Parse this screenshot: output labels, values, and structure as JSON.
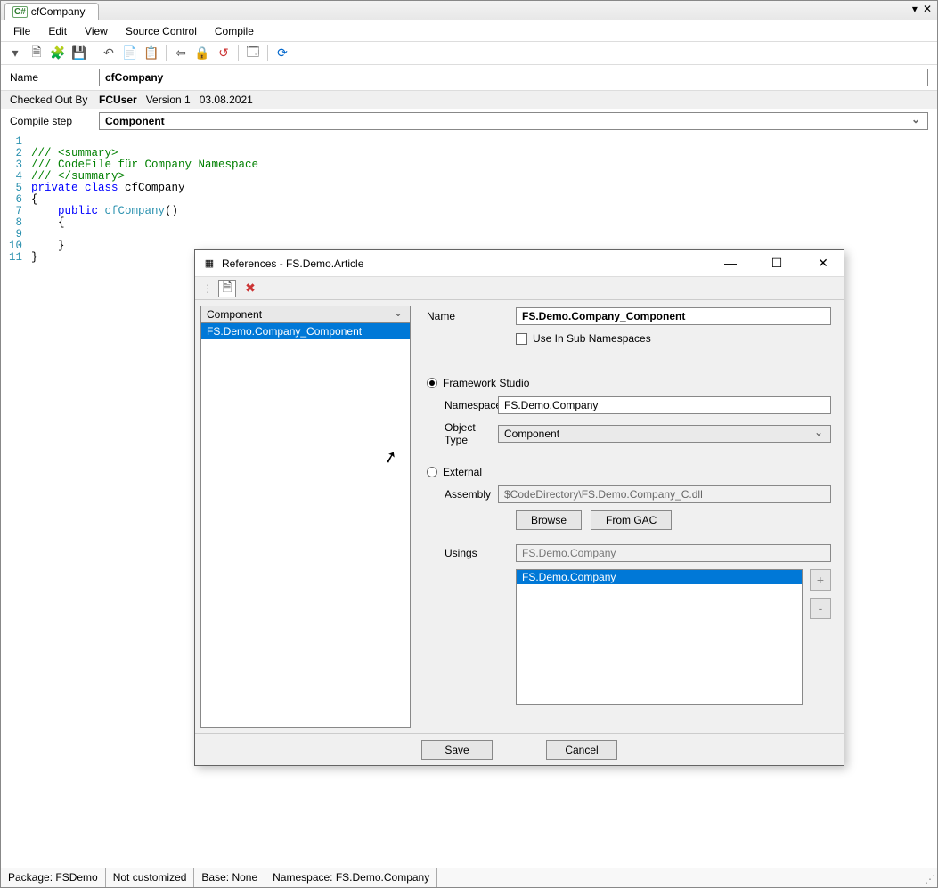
{
  "tab": {
    "label": "cfCompany",
    "badge": "C#"
  },
  "menus": [
    "File",
    "Edit",
    "View",
    "Source Control",
    "Compile"
  ],
  "form": {
    "name_label": "Name",
    "name_value": "cfCompany",
    "checkedout_label": "Checked Out By",
    "checkedout_value": "FCUser",
    "version_label": "Version 1",
    "date_value": "03.08.2021",
    "compilestep_label": "Compile step",
    "compilestep_value": "Component"
  },
  "code": {
    "l1a": "///",
    "l1b": " <summary>",
    "l2a": "///",
    "l2b": " CodeFile für Company Namespace",
    "l3a": "///",
    "l3b": " </summary>",
    "l4a": "private",
    "l4b": " class",
    "l4c": " cfCompany",
    "l5": "{",
    "l6a": "    public",
    "l6b": " cfCompany",
    "l6c": "()",
    "l7": "    {",
    "l9": "    }",
    "l10": "}"
  },
  "lines": [
    "1",
    "2",
    "3",
    "4",
    "5",
    "6",
    "7",
    "8",
    "9",
    "10",
    "11"
  ],
  "dialog": {
    "title": "References - FS.Demo.Article",
    "filter": "Component",
    "list_item": "FS.Demo.Company_Component",
    "name_label": "Name",
    "name_value": "FS.Demo.Company_Component",
    "use_sub_label": "Use In Sub Namespaces",
    "fs_label": "Framework Studio",
    "namespace_label": "Namespace",
    "namespace_value": "FS.Demo.Company",
    "objecttype_label": "Object Type",
    "objecttype_value": "Component",
    "external_label": "External",
    "assembly_label": "Assembly",
    "assembly_value": "$CodeDirectory\\FS.Demo.Company_C.dll",
    "browse_label": "Browse",
    "fromgac_label": "From GAC",
    "usings_label": "Usings",
    "usings_placeholder": "FS.Demo.Company",
    "usings_selected": "FS.Demo.Company",
    "add": "+",
    "remove": "-",
    "save": "Save",
    "cancel": "Cancel"
  },
  "status": {
    "pkg": "Package: FSDemo",
    "cust": "Not customized",
    "base": "Base: None",
    "ns": "Namespace: FS.Demo.Company"
  }
}
